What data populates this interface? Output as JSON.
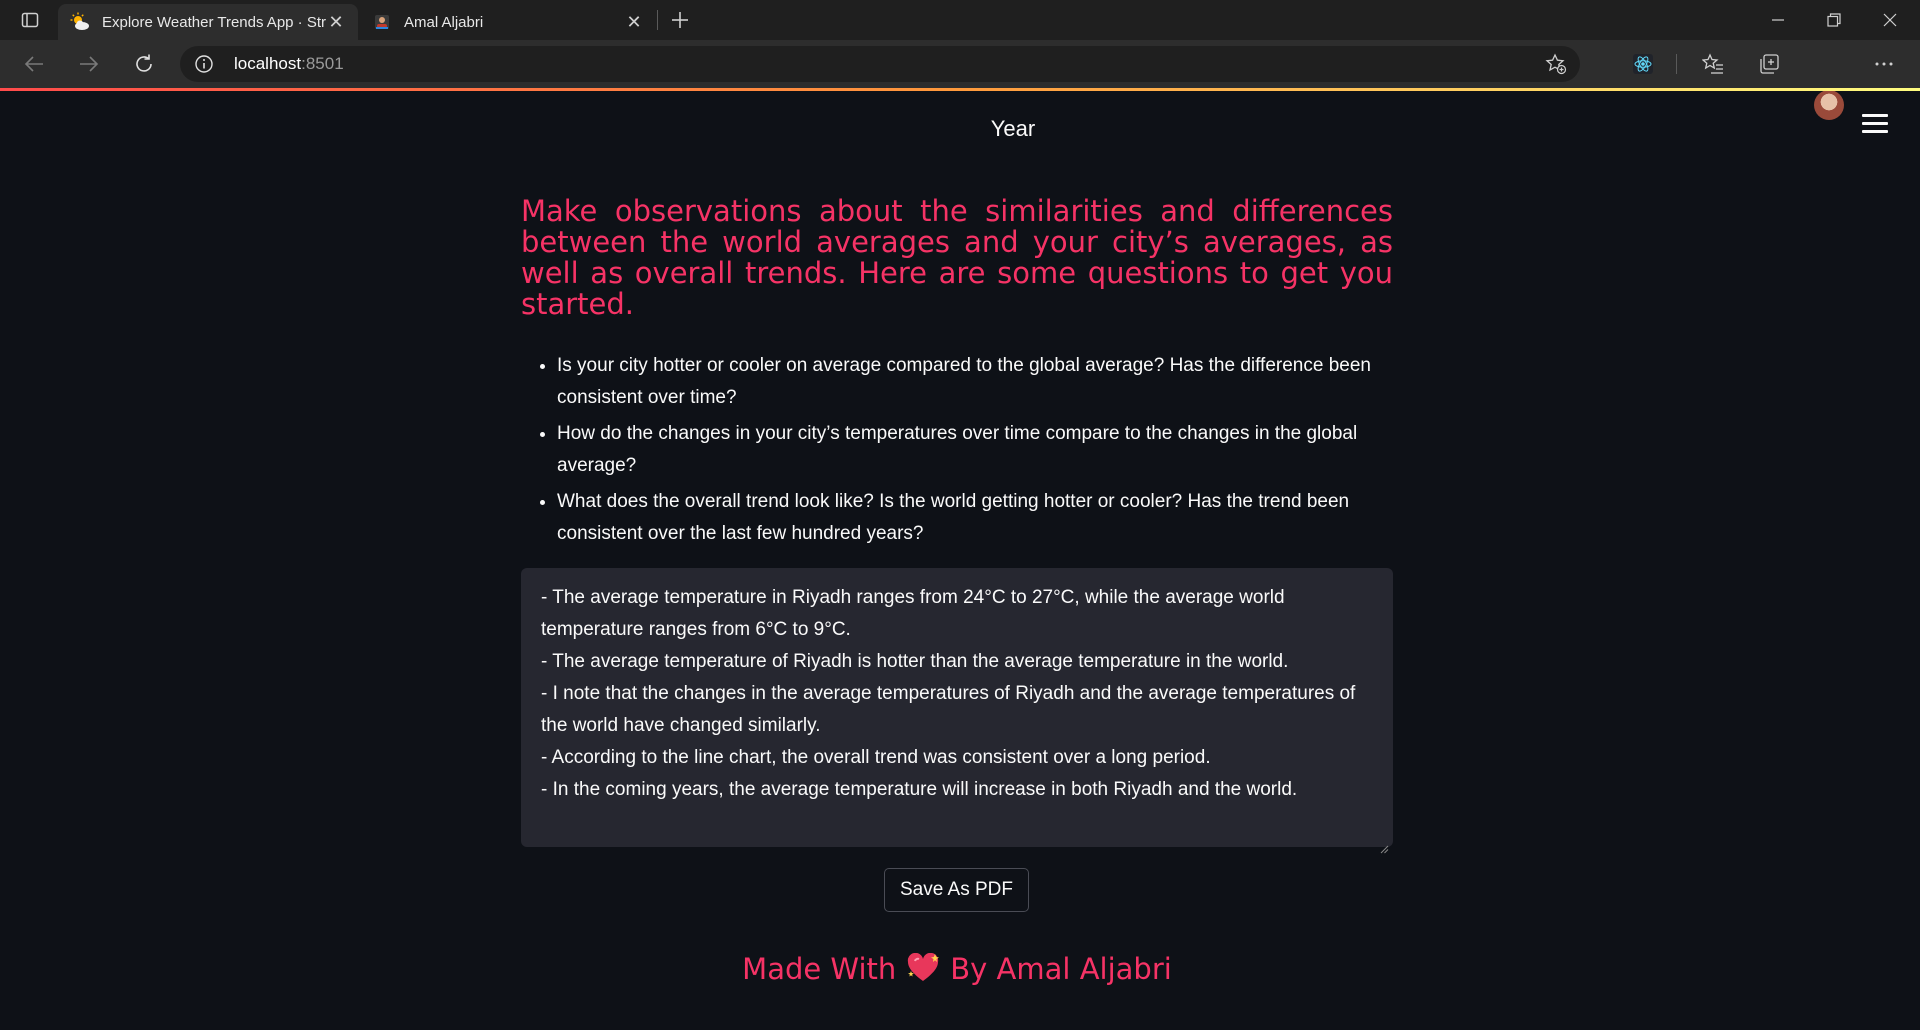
{
  "browser": {
    "tabs": [
      {
        "title": "Explore Weather Trends App · Str",
        "active": true,
        "favicon": "sun-cloud-icon"
      },
      {
        "title": "Amal Aljabri",
        "active": false,
        "favicon": "profile-icon"
      }
    ],
    "url_host": "localhost",
    "url_port": ":8501"
  },
  "app": {
    "chart_axis_label": "Year",
    "heading": "Make observations about the similarities and differences between the world averages and your city’s averages, as well as overall trends. Here are some questions to get you started.",
    "questions": [
      "Is your city hotter or cooler on average compared to the global average? Has the difference been consistent over time?",
      "How do the changes in your city’s temperatures over time compare to the changes in the global average?",
      "What does the overall trend look like? Is the world getting hotter or cooler? Has the trend been consistent over the last few hundred years?"
    ],
    "notes": "- The average temperature in Riyadh ranges from 24°C to 27°C, while the average world temperature ranges from 6°C to 9°C.\n- The average temperature of Riyadh is hotter than the average temperature in the world.\n- I note that the changes in the average temperatures of Riyadh and the average temperatures of the world have changed similarly.\n- According to the line chart, the overall trend was consistent over a long period.\n- In the coming years, the average temperature will increase in both Riyadh and the world.",
    "save_button": "Save As PDF",
    "footer_prefix": "Made With",
    "footer_suffix": "By Amal Aljabri"
  },
  "colors": {
    "accent": "#f63366",
    "background": "#0e1117",
    "textarea_bg": "#262730"
  }
}
